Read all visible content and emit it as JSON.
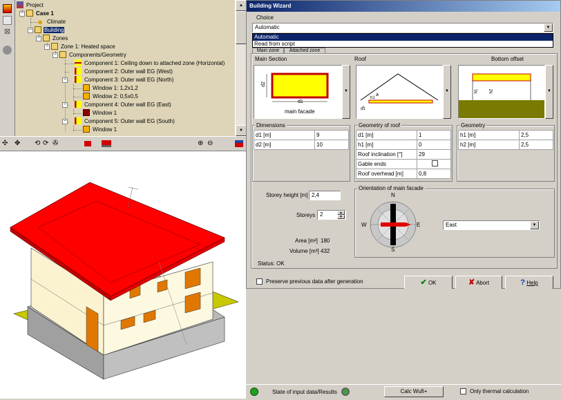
{
  "tree": {
    "items": [
      {
        "label": "Project"
      },
      {
        "label": "Case 1"
      },
      {
        "label": "Climate"
      },
      {
        "label": "Building"
      },
      {
        "label": "Zones"
      },
      {
        "label": "Zone 1: Heated space"
      },
      {
        "label": "Components/Geometry"
      },
      {
        "label": "Component 1: Ceiling down to attached zone (Horizontal)"
      },
      {
        "label": "Component 2: Outer wall EG (West)"
      },
      {
        "label": "Component 3: Outer wall EG (North)"
      },
      {
        "label": "Window 1: 1,2x1,2"
      },
      {
        "label": "Window 2: 0,5x0,5"
      },
      {
        "label": "Component 4: Outer wall EG (East)"
      },
      {
        "label": "Window 1"
      },
      {
        "label": "Component 5: Outer wall EG (South)"
      },
      {
        "label": "Window 1"
      }
    ]
  },
  "wizard": {
    "title": "Building Wizard",
    "choice_label": "Choice",
    "choice_value": "Automatic",
    "choice_options": [
      "Automatic",
      "Read from script"
    ],
    "tabs": [
      "Main zone",
      "Attached zone"
    ],
    "main_section_label": "Main Section",
    "roof_label": "Roof",
    "bottom_offset_label": "Bottom offset",
    "pic_main_caption": "main facade",
    "pic_main_d1": "d1",
    "pic_main_d2": "d2",
    "pic_roof_a": "a",
    "pic_roof_h1": "h1",
    "pic_roof_d1": "d1",
    "pic_bottom_h1": "h1",
    "pic_bottom_h2": "h2",
    "dimensions": {
      "title": "Dimensions",
      "rows": [
        {
          "k": "d1 [m]",
          "v": "9"
        },
        {
          "k": "d2 [m]",
          "v": "10"
        }
      ]
    },
    "roof_geometry": {
      "title": "Geometry of roof",
      "rows": [
        {
          "k": "d1 [m]",
          "v": "1"
        },
        {
          "k": "h1 [m]",
          "v": "0"
        },
        {
          "k": "Roof inclination [°]",
          "v": "29"
        },
        {
          "k": "Gable ends",
          "v": ""
        },
        {
          "k": "Roof overhead [m]",
          "v": "0,8"
        }
      ]
    },
    "geometry": {
      "title": "Geometry",
      "rows": [
        {
          "k": "h1 [m]",
          "v": "2,5"
        },
        {
          "k": "h2 [m]",
          "v": "2,5"
        }
      ]
    },
    "storey_height_label": "Storey height [m]",
    "storey_height_value": "2,4",
    "storeys_label": "Storeys",
    "storeys_value": "2",
    "area_label": "Area [m²]",
    "area_value": "180",
    "volume_label": "Volume [m³]",
    "volume_value": "432",
    "orientation_title": "Orientation of main facade",
    "compass": {
      "n": "N",
      "s": "S",
      "e": "E",
      "w": "W"
    },
    "orientation_value": "East",
    "status": "Status: OK",
    "preserve_label": "Preserve previous data after generation",
    "ok_label": "OK",
    "abort_label": "Abort",
    "help_label": "Help"
  },
  "statusbar": {
    "state_label": "State of input data/Results",
    "calc_button": "Calc Wufi+",
    "thermal_label": "Only thermal calculation"
  }
}
